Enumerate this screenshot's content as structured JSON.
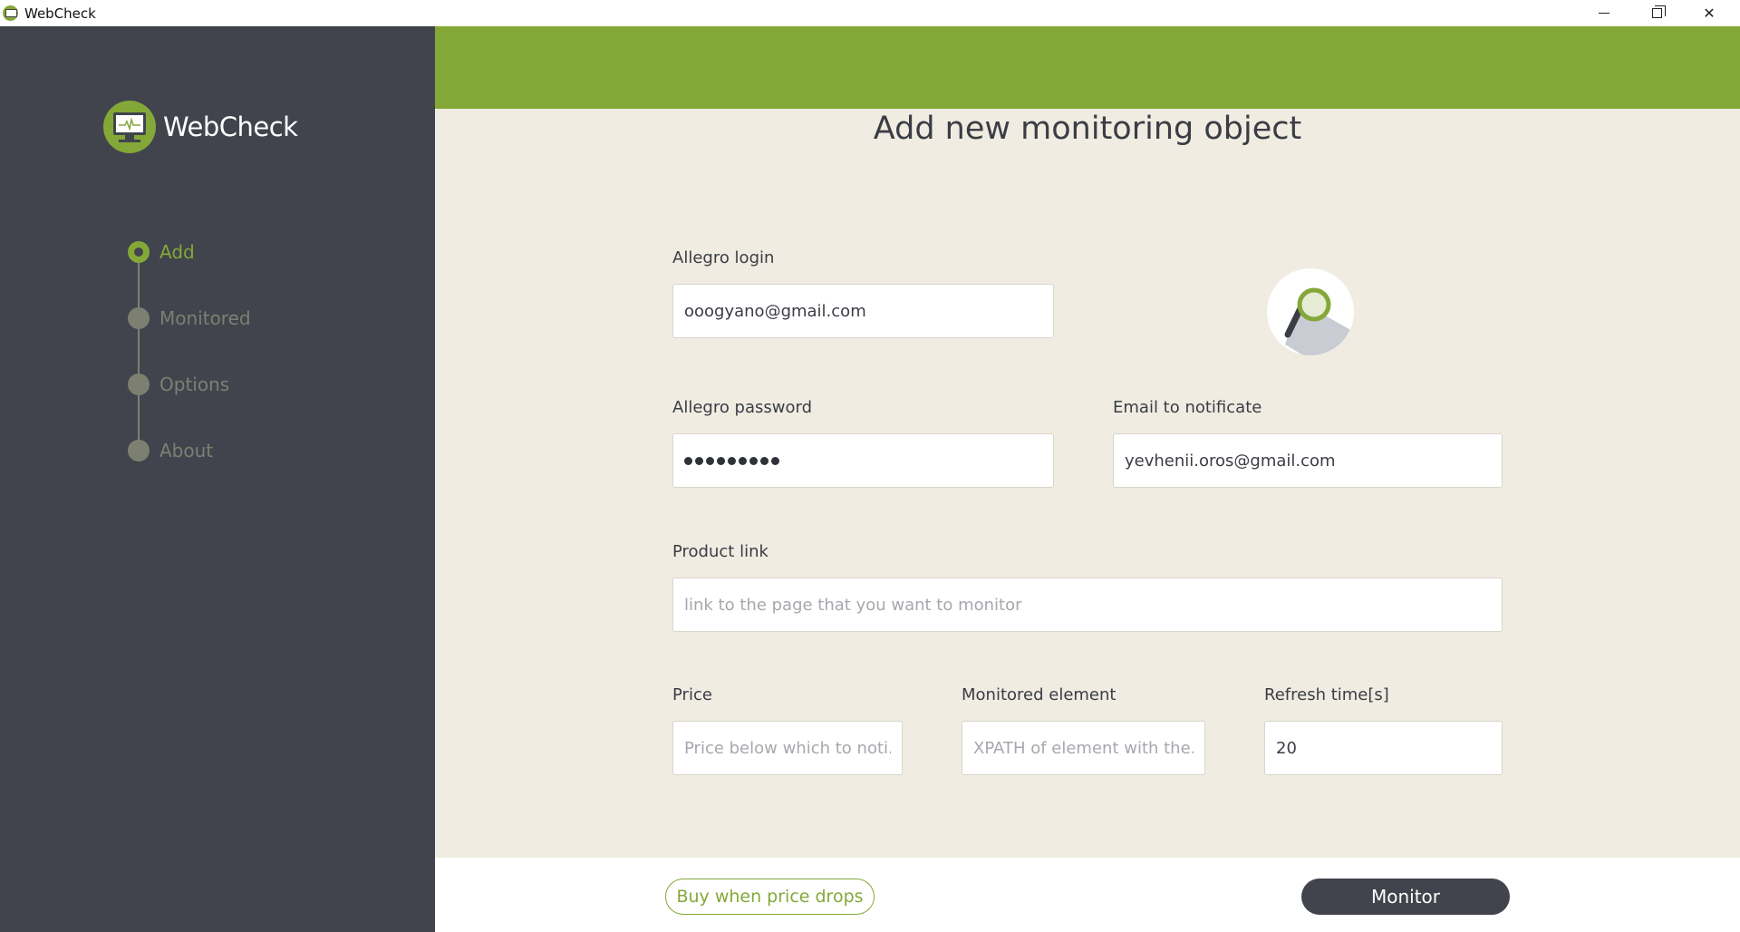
{
  "window": {
    "title": "WebCheck"
  },
  "sidebar": {
    "brand": "WebCheck",
    "items": [
      {
        "label": "Add",
        "active": true
      },
      {
        "label": "Monitored",
        "active": false
      },
      {
        "label": "Options",
        "active": false
      },
      {
        "label": "About",
        "active": false
      }
    ]
  },
  "main": {
    "title": "Add new monitoring object",
    "allegro_login": {
      "label": "Allegro login",
      "value": "ooogyano@gmail.com"
    },
    "allegro_password": {
      "label": "Allegro password"
    },
    "email": {
      "label": "Email to notificate",
      "value": "yevhenii.oros@gmail.com"
    },
    "product_link": {
      "label": "Product link",
      "placeholder": "link to the page that you want to monitor"
    },
    "price": {
      "label": "Price",
      "placeholder": "Price below which to noti..."
    },
    "monitored_element": {
      "label": "Monitored element",
      "placeholder": "XPATH of element with the..."
    },
    "refresh_time": {
      "label": "Refresh time[s]",
      "value": "20"
    }
  },
  "footer": {
    "buy_button": "Buy when price drops",
    "monitor_button": "Monitor"
  },
  "colors": {
    "accent": "#84a838",
    "sidebar": "#41444d",
    "background": "#f0ece1"
  }
}
